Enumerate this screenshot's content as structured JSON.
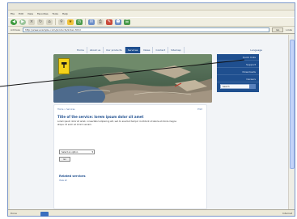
{
  "browser": {
    "menu": [
      "File",
      "Edit",
      "View",
      "Favorites",
      "Tools",
      "Help"
    ],
    "address_label": "Address",
    "address_value": "http://www.example.com/products/index.html",
    "go_label": "Go",
    "links_label": "Links",
    "status_left": "Done",
    "status_right": "Internet"
  },
  "site": {
    "nav": [
      "Home",
      "About us",
      "Our products",
      "Services",
      "News",
      "Contact",
      "Sitemap"
    ],
    "active_nav_index": 3,
    "nav_right": "Language",
    "side_items": [
      "Quick links",
      "Support",
      "Downloads",
      "Careers"
    ],
    "side_search_placeholder": "Search",
    "breadcrumb": "Home > Services",
    "breadcrumb_right": "Print",
    "title": "Title of the service: lorem ipsum dolor sit amet",
    "body": "Lorem ipsum dolor sit amet, consectetur adipiscing elit, sed do eiusmod tempor incididunt ut labore et dolore magna aliqua. Ut enim ad minim veniam.",
    "select_value": "Select an option",
    "button_label": "Go",
    "subhead": "Related services",
    "sublink": "View all"
  },
  "colors": {
    "brand_blue": "#1f4f8f",
    "logo_yellow": "#f5d21a"
  }
}
